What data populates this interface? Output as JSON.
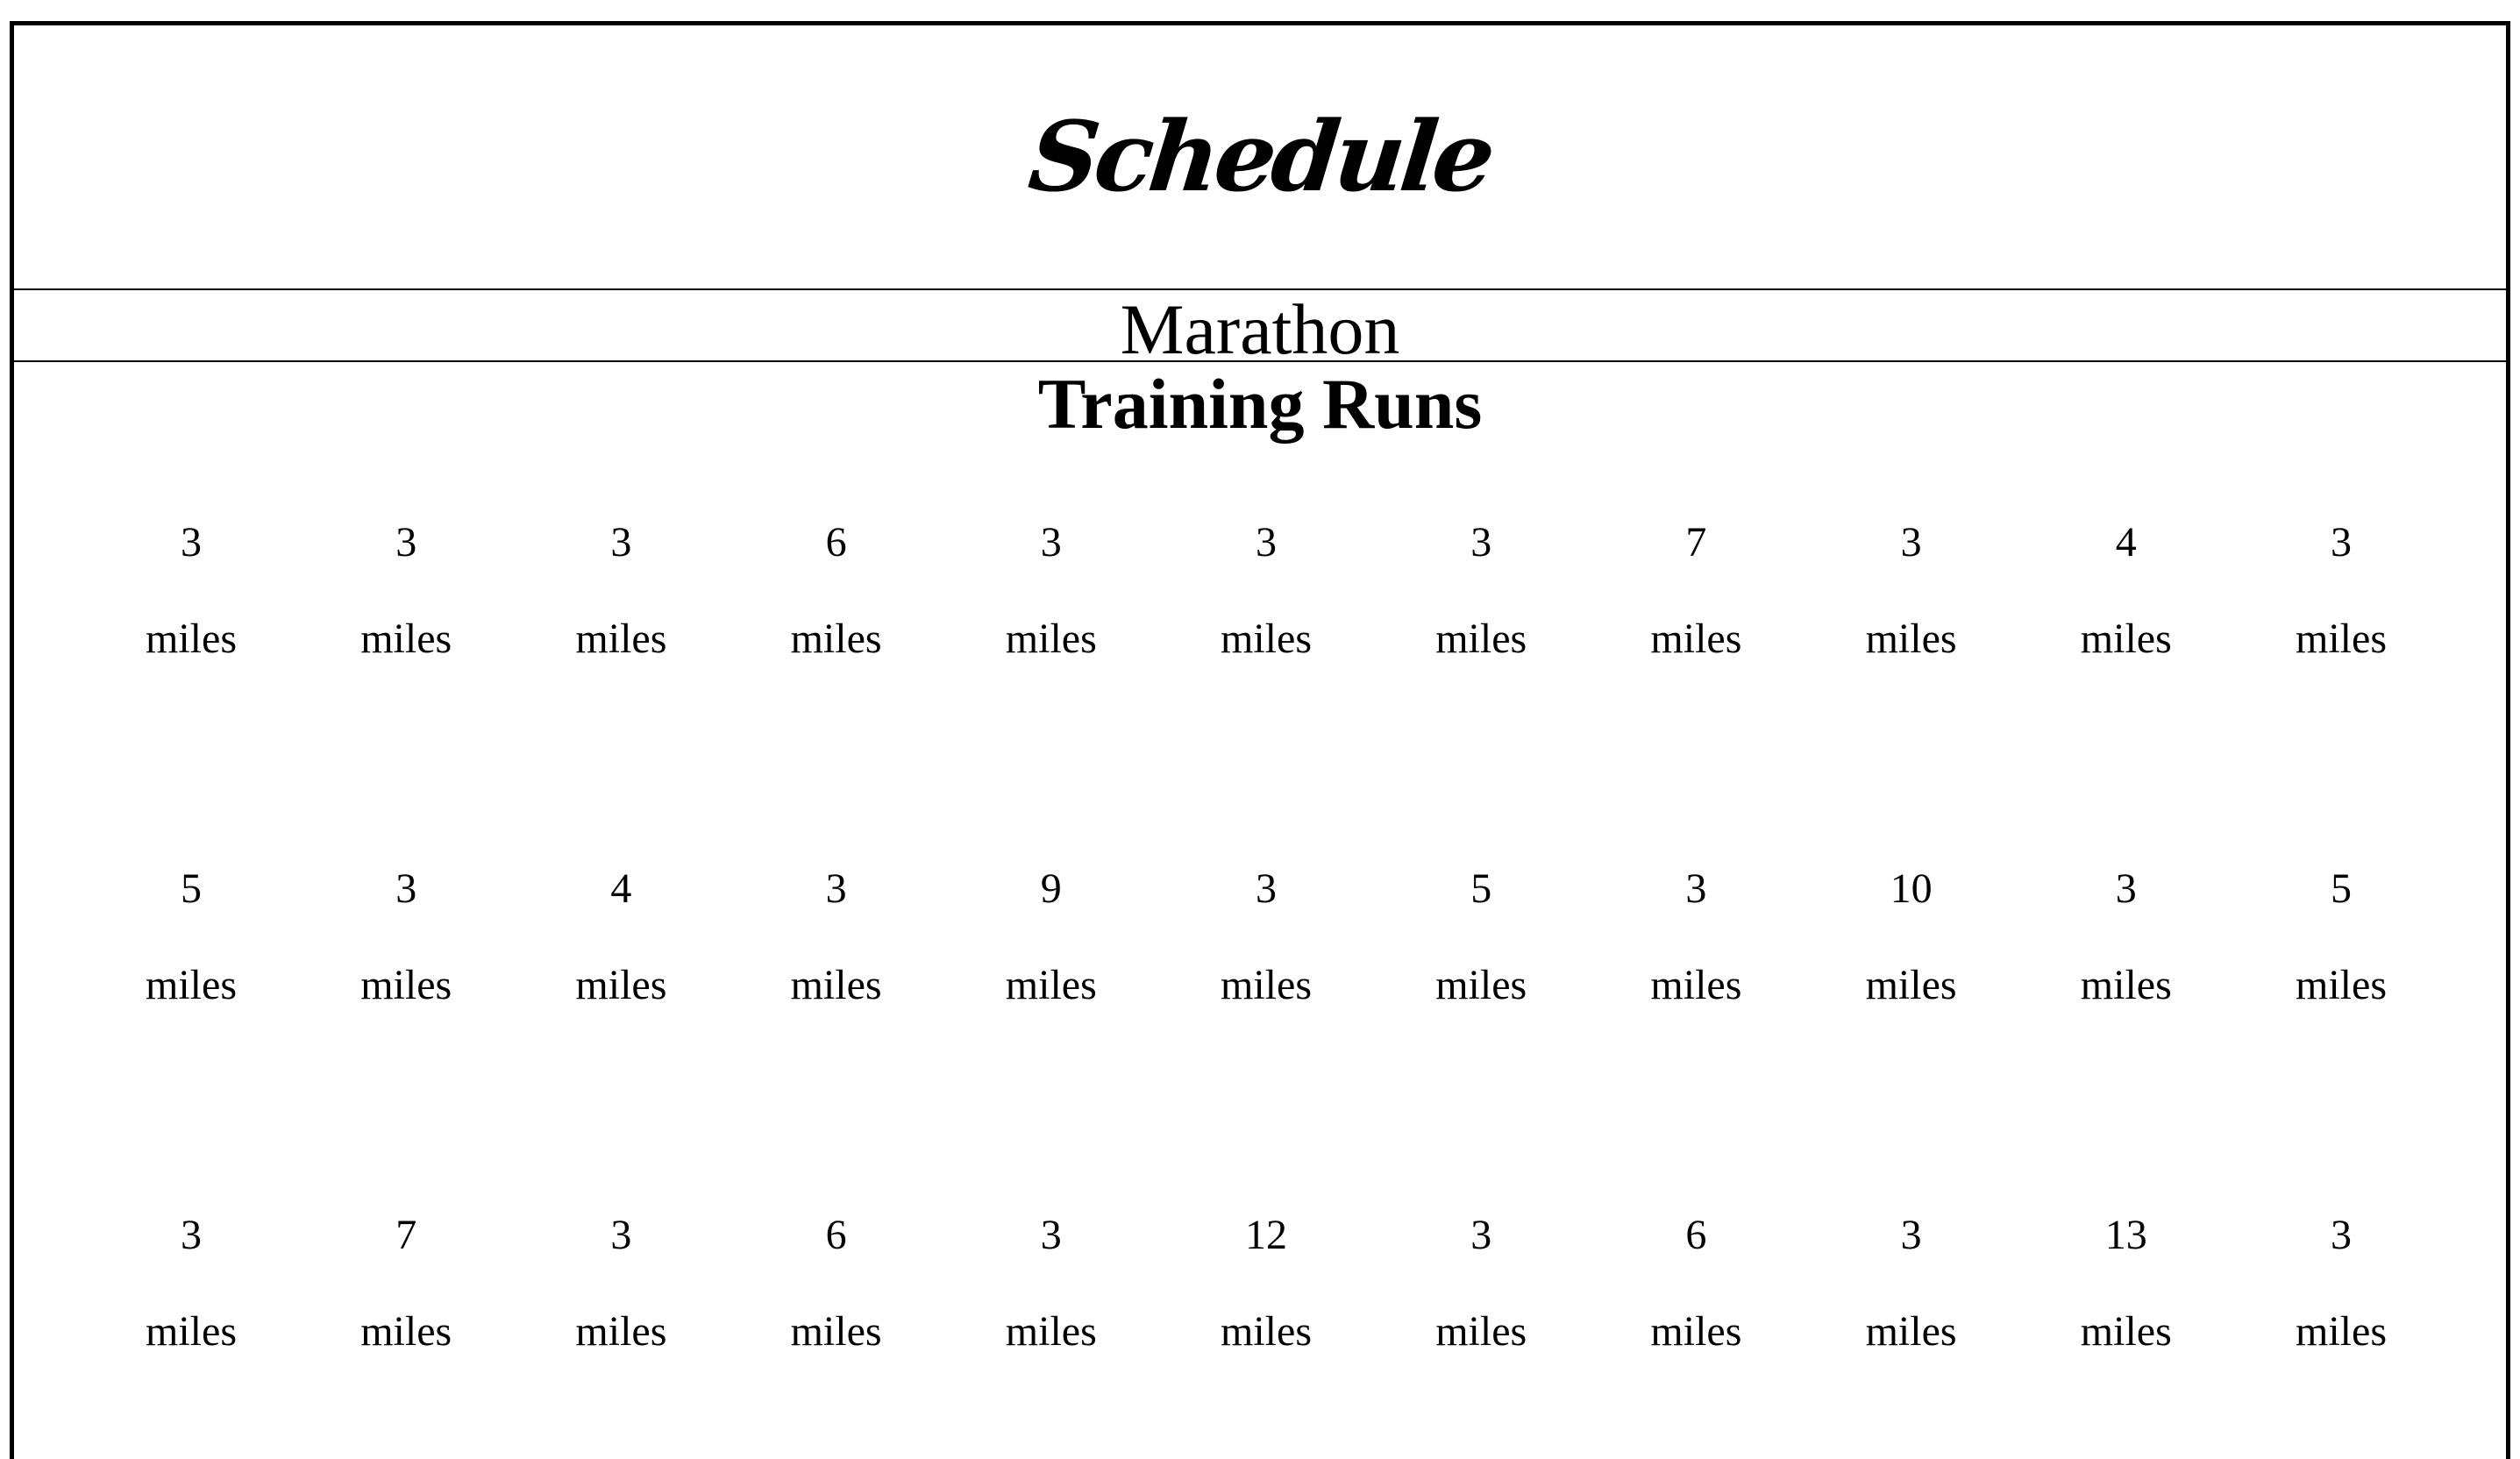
{
  "header": {
    "title": "Schedule",
    "subtitle": "Marathon"
  },
  "section": {
    "heading": "Training Runs"
  },
  "runs": [
    [
      {
        "distance": "3",
        "unit": "miles"
      },
      {
        "distance": "3",
        "unit": "miles"
      },
      {
        "distance": "3",
        "unit": "miles"
      },
      {
        "distance": "6",
        "unit": "miles"
      },
      {
        "distance": "3",
        "unit": "miles"
      },
      {
        "distance": "3",
        "unit": "miles"
      },
      {
        "distance": "3",
        "unit": "miles"
      },
      {
        "distance": "7",
        "unit": "miles"
      },
      {
        "distance": "3",
        "unit": "miles"
      },
      {
        "distance": "4",
        "unit": "miles"
      },
      {
        "distance": "3",
        "unit": "miles"
      }
    ],
    [
      {
        "distance": "5",
        "unit": "miles"
      },
      {
        "distance": "3",
        "unit": "miles"
      },
      {
        "distance": "4",
        "unit": "miles"
      },
      {
        "distance": "3",
        "unit": "miles"
      },
      {
        "distance": "9",
        "unit": "miles"
      },
      {
        "distance": "3",
        "unit": "miles"
      },
      {
        "distance": "5",
        "unit": "miles"
      },
      {
        "distance": "3",
        "unit": "miles"
      },
      {
        "distance": "10",
        "unit": "miles"
      },
      {
        "distance": "3",
        "unit": "miles"
      },
      {
        "distance": "5",
        "unit": "miles"
      }
    ],
    [
      {
        "distance": "3",
        "unit": "miles"
      },
      {
        "distance": "7",
        "unit": "miles"
      },
      {
        "distance": "3",
        "unit": "miles"
      },
      {
        "distance": "6",
        "unit": "miles"
      },
      {
        "distance": "3",
        "unit": "miles"
      },
      {
        "distance": "12",
        "unit": "miles"
      },
      {
        "distance": "3",
        "unit": "miles"
      },
      {
        "distance": "6",
        "unit": "miles"
      },
      {
        "distance": "3",
        "unit": "miles"
      },
      {
        "distance": "13",
        "unit": "miles"
      },
      {
        "distance": "3",
        "unit": "miles"
      }
    ]
  ]
}
